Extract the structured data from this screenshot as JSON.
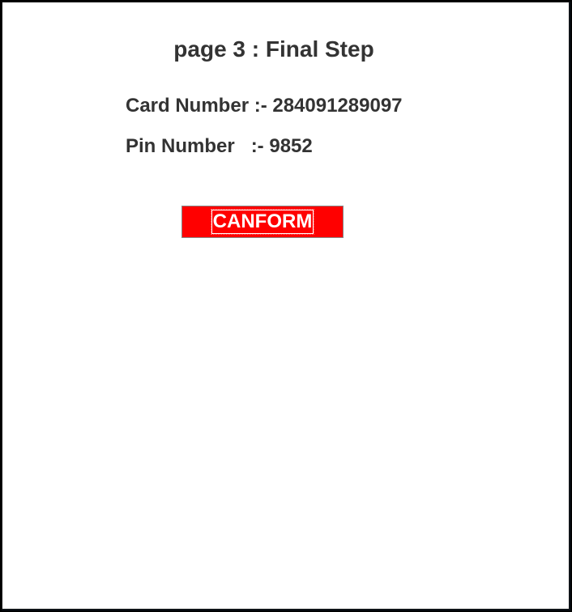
{
  "page": {
    "title": "page 3 : Final Step"
  },
  "card": {
    "label": "Card Number :- ",
    "value": "284091289097"
  },
  "pin": {
    "label": "Pin Number   :- ",
    "value": "9852"
  },
  "actions": {
    "confirm_label": "CANFORM",
    "confirm_color": "#ff0000"
  }
}
